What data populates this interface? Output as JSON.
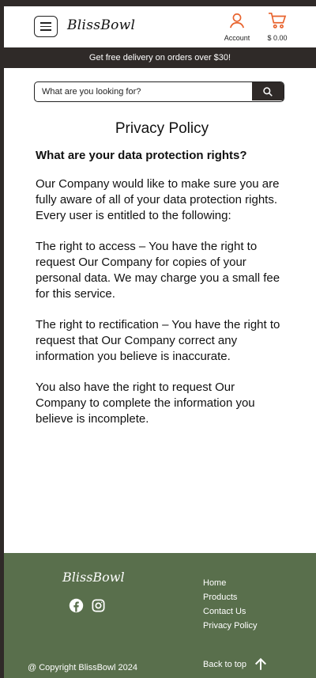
{
  "header": {
    "logo": "BlissBowl",
    "account_label": "Account",
    "cart_total": "$ 0.00"
  },
  "promo": {
    "text": "Get free delivery on orders over $30!"
  },
  "search": {
    "placeholder": "What are you looking for?"
  },
  "content": {
    "title": "Privacy Policy",
    "subtitle": "What are your data protection rights?",
    "paragraphs": [
      "Our Company would like to make sure you are fully aware of all of your data protection rights. Every user is entitled to the following:",
      "The right to access – You have the right to request Our Company for copies of your personal data. We may charge you a small fee for this service.",
      "The right to rectification – You have the right to request that Our Company correct any information you believe is inaccurate.",
      "You also have the right to request Our Company to complete the information you believe is incomplete."
    ]
  },
  "footer": {
    "logo": "BlissBowl",
    "links": [
      "Home",
      "Products",
      "Contact Us",
      "Privacy Policy"
    ],
    "copyright": "@ Copyright BlissBowl 2024",
    "back_to_top": "Back to top"
  },
  "colors": {
    "accent": "#e8622c",
    "dark": "#2f2a28",
    "footer_bg": "#596f4c"
  }
}
